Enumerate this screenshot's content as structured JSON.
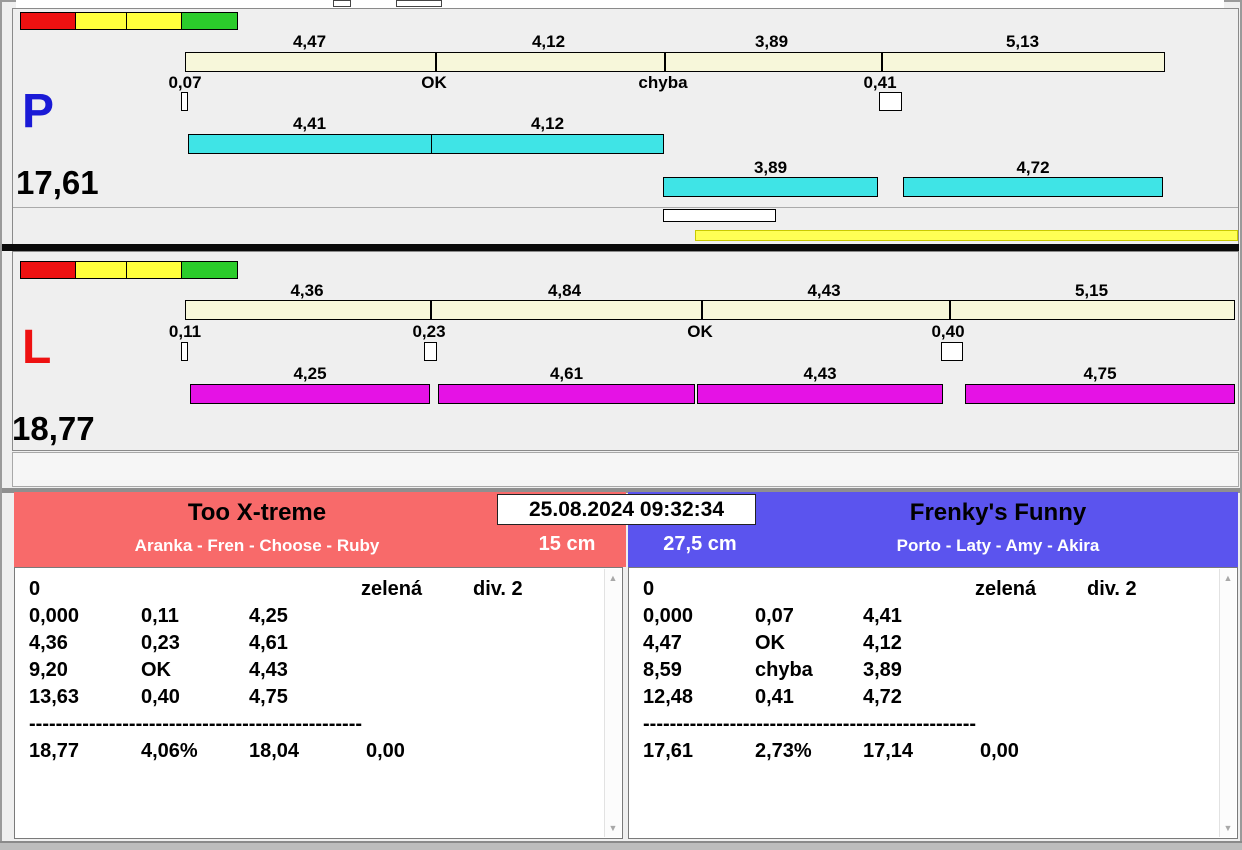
{
  "colors": {
    "background": "#efefef",
    "lane_p_bar_cyan": "#3fe4e6",
    "lane_l_bar_magenta": "#e512e5",
    "ruler_cream": "#f7f7da",
    "yellow_bar": "#ffff55",
    "team_left_header": "#f86a6a",
    "team_right_header": "#5b54ee",
    "legend_lights": [
      "#ee1111",
      "#ffff3c",
      "#ffff3c",
      "#2bcc2b"
    ],
    "letter_p": "#1a1ad6",
    "letter_l": "#ee1111"
  },
  "icons": {
    "scroll_up": "▲",
    "scroll_down": "▼"
  },
  "clock": "25.08.2024 09:32:34",
  "lane_p": {
    "letter": "P",
    "total": "17,61",
    "splits": [
      "4,47",
      "4,12",
      "3,89",
      "5,13"
    ],
    "marks": [
      "0,07",
      "OK",
      "chyba",
      "0,41"
    ],
    "run1": [
      "4,41",
      "4,12"
    ],
    "run2": [
      "3,89",
      "4,72"
    ]
  },
  "lane_l": {
    "letter": "L",
    "total": "18,77",
    "splits": [
      "4,36",
      "4,84",
      "4,43",
      "5,15"
    ],
    "marks": [
      "0,11",
      "0,23",
      "OK",
      "0,40"
    ],
    "runs": [
      "4,25",
      "4,61",
      "4,43",
      "4,75"
    ]
  },
  "team_left": {
    "name": "Too X-treme",
    "lineup": "Aranka - Fren - Choose - Ruby",
    "jump_height": "15 cm",
    "status_row": [
      "0",
      "zelená",
      "div. 2"
    ],
    "rows": [
      [
        "0,000",
        "0,11",
        "4,25"
      ],
      [
        "4,36",
        "0,23",
        "4,61"
      ],
      [
        "9,20",
        "OK",
        "4,43"
      ],
      [
        "13,63",
        "0,40",
        "4,75"
      ]
    ],
    "divider": "--------------------------------------------------",
    "summary": [
      "18,77",
      "4,06%",
      "18,04",
      "0,00"
    ]
  },
  "team_right": {
    "name": "Frenky's Funny",
    "lineup": "Porto - Laty - Amy - Akira",
    "jump_height": "27,5 cm",
    "status_row": [
      "0",
      "zelená",
      "div. 2"
    ],
    "rows": [
      [
        "0,000",
        "0,07",
        "4,41"
      ],
      [
        "4,47",
        "OK",
        "4,12"
      ],
      [
        "8,59",
        "chyba",
        "3,89"
      ],
      [
        "12,48",
        "0,41",
        "4,72"
      ]
    ],
    "divider": "--------------------------------------------------",
    "summary": [
      "17,61",
      "2,73%",
      "17,14",
      "0,00"
    ]
  }
}
